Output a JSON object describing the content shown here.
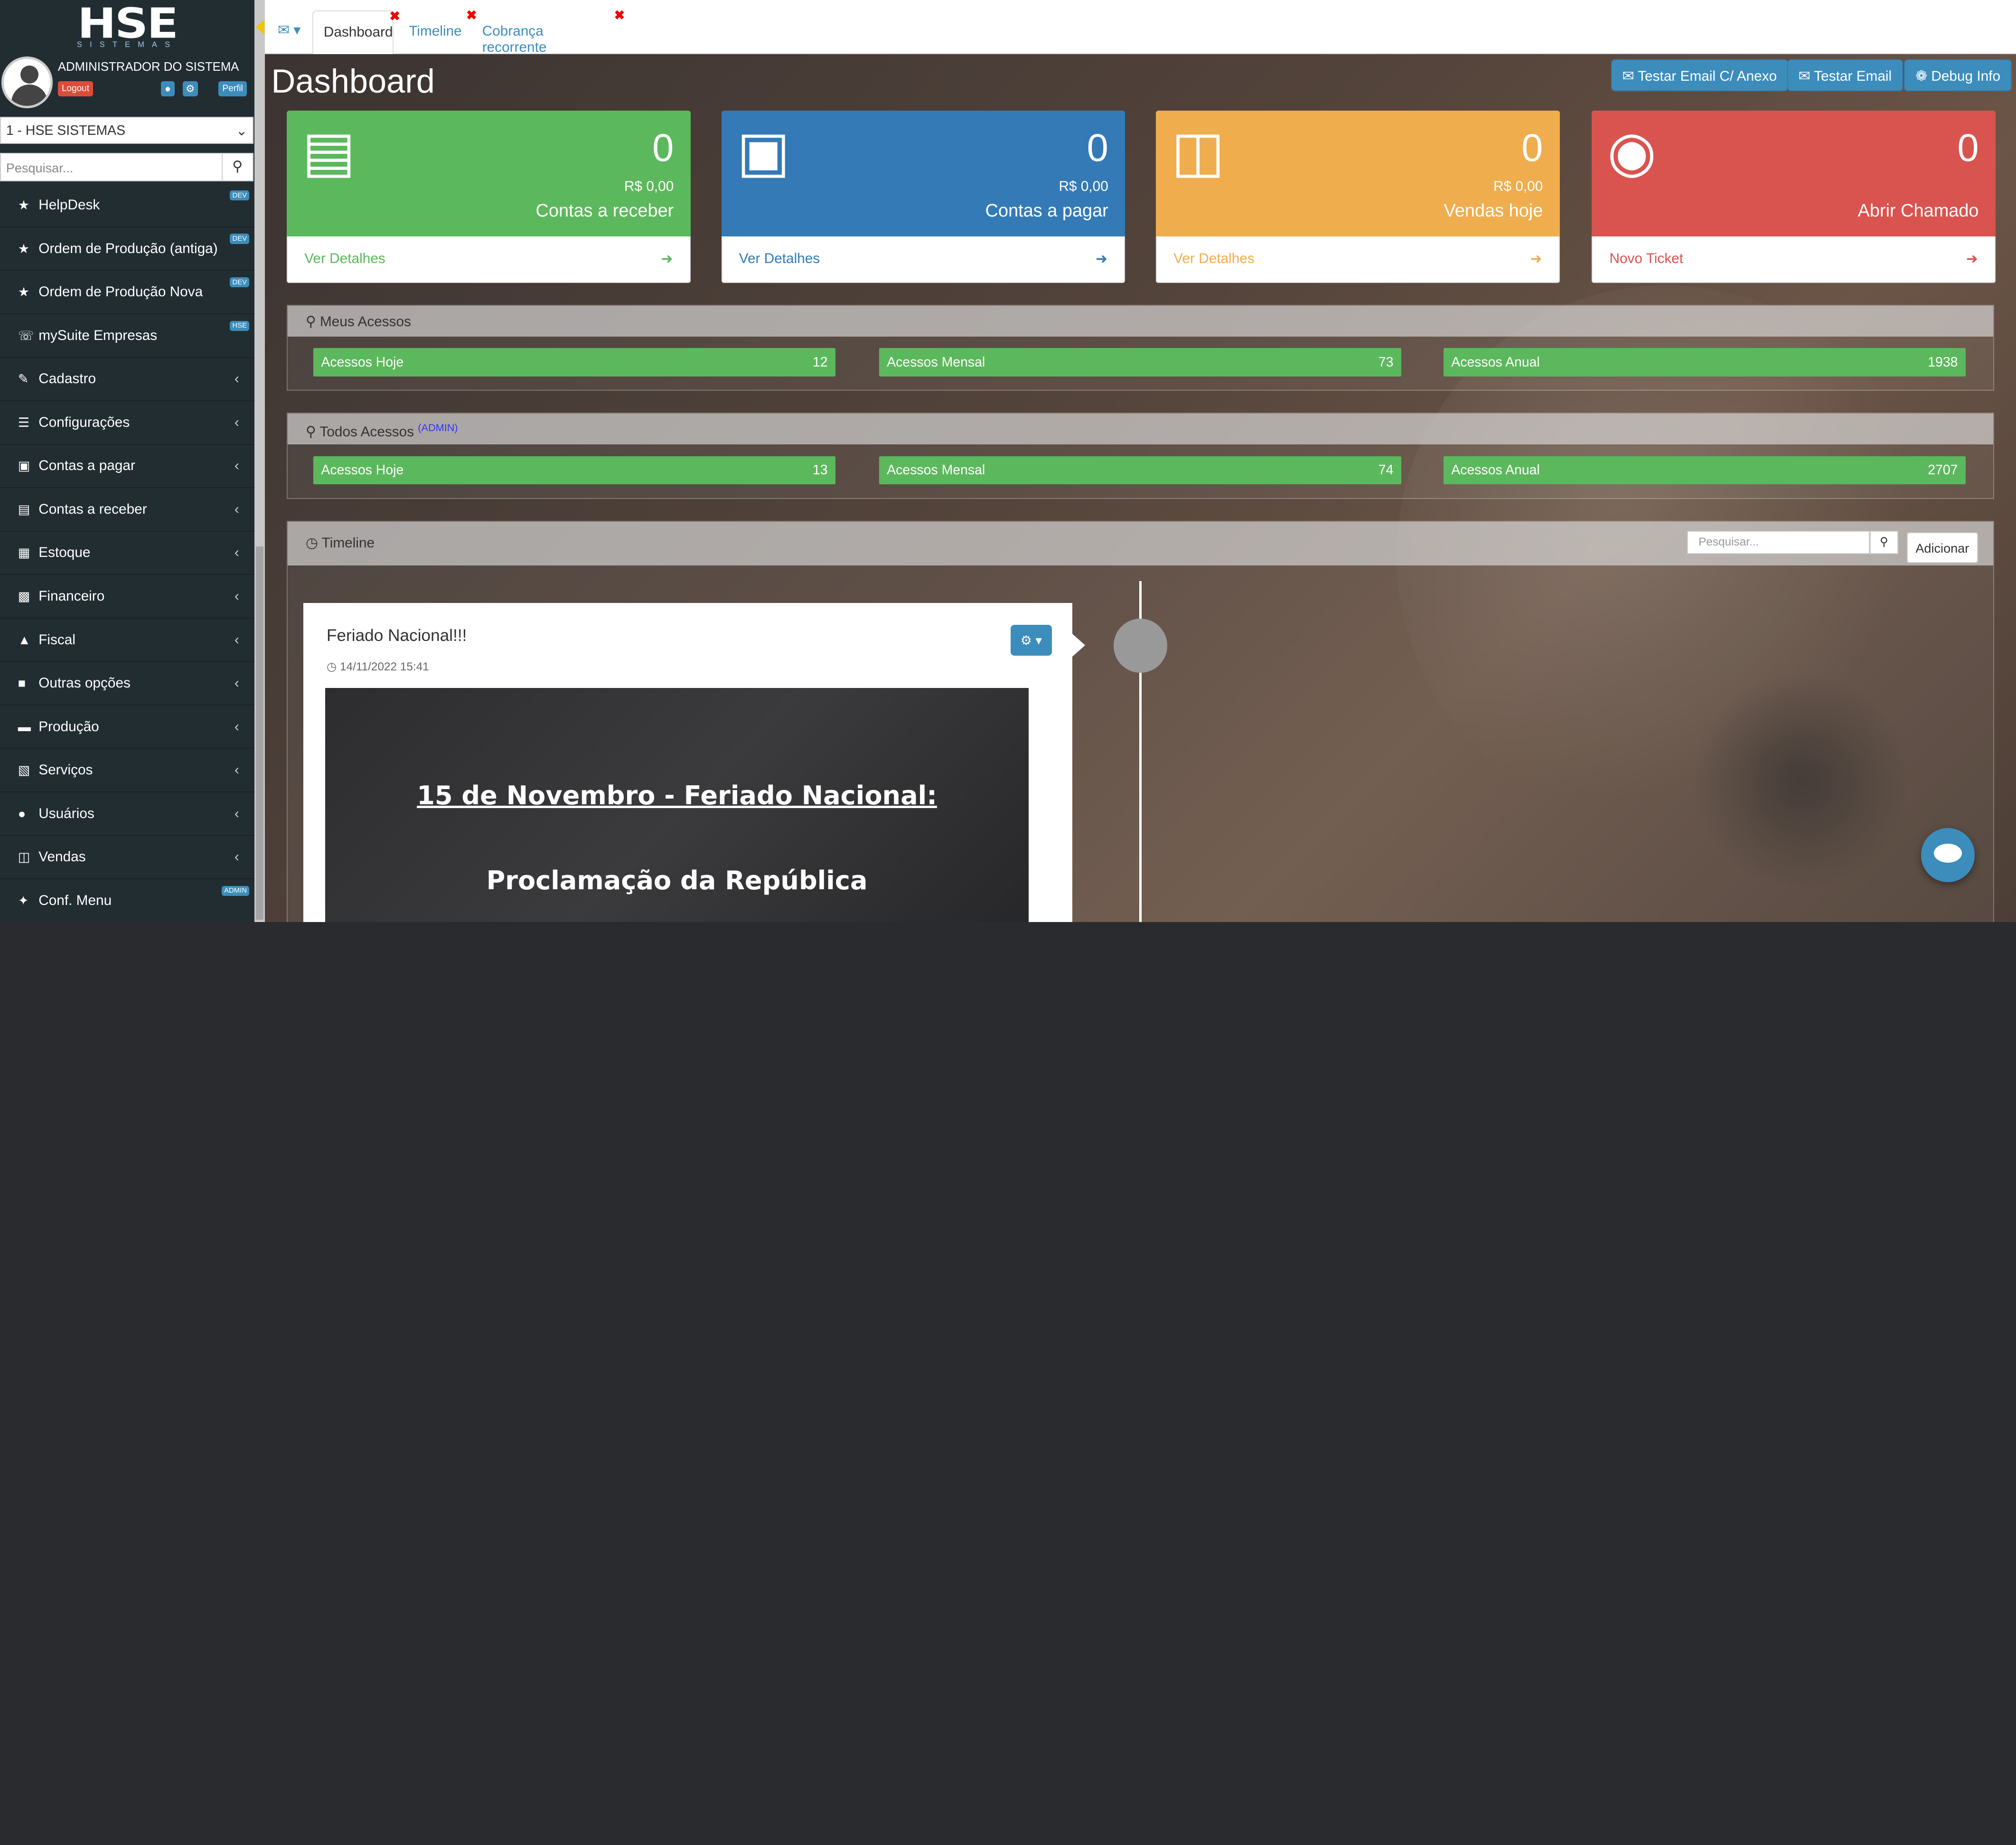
{
  "sidebar": {
    "logo_text": "HSE",
    "logo_sub": "SISTEMAS",
    "user_name": "ADMINISTRADOR DO SISTEMA",
    "logout": "Logout",
    "perfil": "Perfil",
    "company": "1 - HSE SISTEMAS",
    "search_placeholder": "Pesquisar...",
    "items": [
      {
        "label": "HelpDesk",
        "icon": "star-icon",
        "tag": "DEV"
      },
      {
        "label": "Ordem de Produção (antiga)",
        "icon": "star-icon",
        "tag": "DEV"
      },
      {
        "label": "Ordem de Produção Nova",
        "icon": "star-icon",
        "tag": "DEV"
      },
      {
        "label": "mySuite Empresas",
        "icon": "headset-icon",
        "tag": "HSE"
      },
      {
        "label": "Cadastro",
        "icon": "edit-icon"
      },
      {
        "label": "Configurações",
        "icon": "sliders-icon"
      },
      {
        "label": "Contas a pagar",
        "icon": "money-icon"
      },
      {
        "label": "Contas a receber",
        "icon": "credit-card-icon"
      },
      {
        "label": "Estoque",
        "icon": "cubes-icon"
      },
      {
        "label": "Financeiro",
        "icon": "bar-chart-icon"
      },
      {
        "label": "Fiscal",
        "icon": "bank-icon"
      },
      {
        "label": "Outras opções",
        "icon": "briefcase-icon"
      },
      {
        "label": "Produção",
        "icon": "truck-icon"
      },
      {
        "label": "Serviços",
        "icon": "calculator-icon"
      },
      {
        "label": "Usuários",
        "icon": "user-icon"
      },
      {
        "label": "Vendas",
        "icon": "cart-icon"
      },
      {
        "label": "Conf. Menu",
        "icon": "pin-icon",
        "tag": "ADMIN"
      }
    ]
  },
  "tabs": [
    {
      "label": "Dashboard"
    },
    {
      "label": "Timeline"
    },
    {
      "label": "Cobrança recorrente"
    }
  ],
  "page_title": "Dashboard",
  "actions": [
    "Testar Email C/ Anexo",
    "Testar Email",
    "Debug Info"
  ],
  "boxes": [
    {
      "count": "0",
      "amount": "R$ 0,00",
      "label": "Contas a receber",
      "link": "Ver Detalhes",
      "color": "#5cb85c",
      "icon": "credit-card-icon"
    },
    {
      "count": "0",
      "amount": "R$ 0,00",
      "label": "Contas a pagar",
      "link": "Ver Detalhes",
      "color": "#337ab7",
      "icon": "money-icon"
    },
    {
      "count": "0",
      "amount": "R$ 0,00",
      "label": "Vendas hoje",
      "link": "Ver Detalhes",
      "color": "#f0ad4e",
      "icon": "cart-icon"
    },
    {
      "count": "0",
      "label": "Abrir Chamado",
      "link": "Novo Ticket",
      "color": "#d9534f",
      "icon": "life-ring-icon"
    }
  ],
  "meus_acessos": {
    "title": "Meus Acessos",
    "items": [
      {
        "label": "Acessos Hoje",
        "value": "12"
      },
      {
        "label": "Acessos Mensal",
        "value": "73"
      },
      {
        "label": "Acessos Anual",
        "value": "1938"
      }
    ]
  },
  "todos_acessos": {
    "title": "Todos Acessos",
    "tag": "(ADMIN)",
    "items": [
      {
        "label": "Acessos Hoje",
        "value": "13"
      },
      {
        "label": "Acessos Mensal",
        "value": "74"
      },
      {
        "label": "Acessos Anual",
        "value": "2707"
      }
    ]
  },
  "timeline": {
    "title": "Timeline",
    "search_placeholder": "Pesquisar...",
    "add": "Adicionar",
    "post": {
      "title": "Feriado Nacional!!!",
      "date": "14/11/2022 15:41",
      "image_line1": "15 de Novembro - Feriado Nacional:",
      "image_line2": "Proclamação da República"
    }
  }
}
